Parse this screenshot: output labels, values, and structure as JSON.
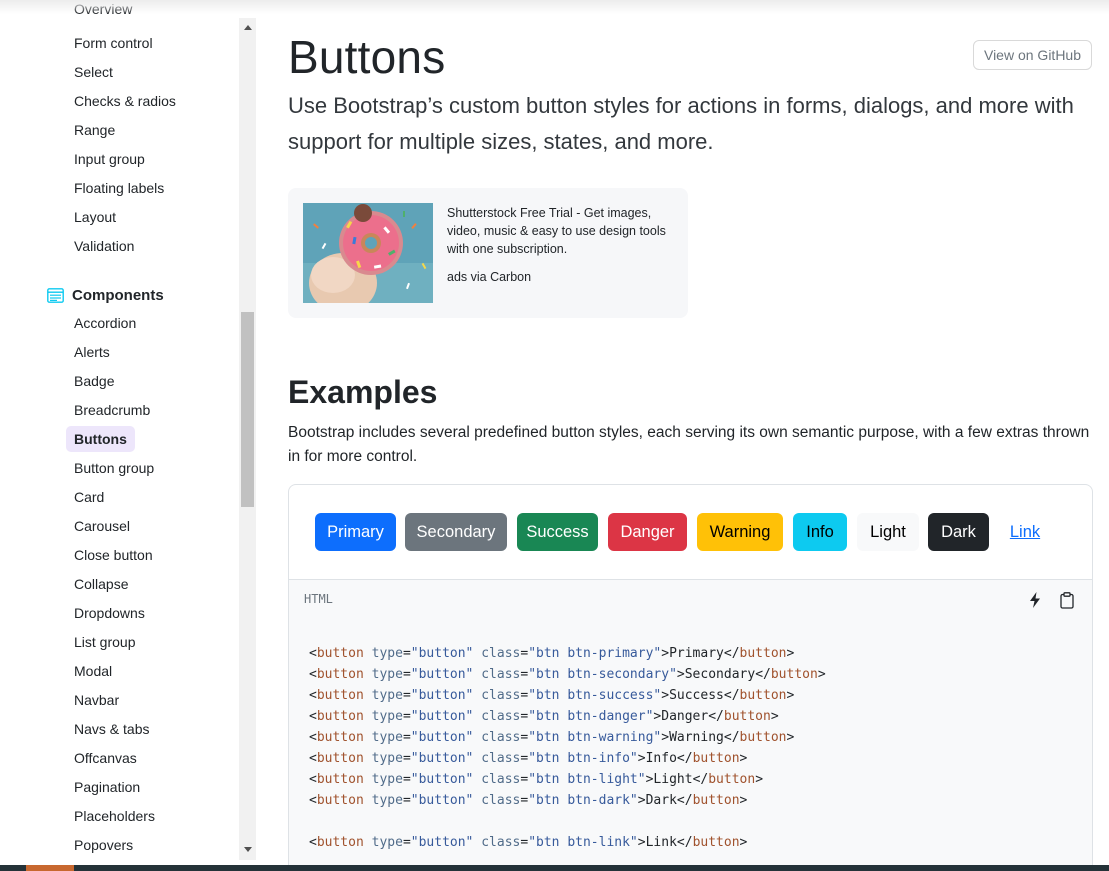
{
  "sidebar": {
    "cut_item": "Overview",
    "forms_items": [
      "Form control",
      "Select",
      "Checks & radios",
      "Range",
      "Input group",
      "Floating labels",
      "Layout",
      "Validation"
    ],
    "components_heading": "Components",
    "components_items": [
      "Accordion",
      "Alerts",
      "Badge",
      "Breadcrumb",
      "Buttons",
      "Button group",
      "Card",
      "Carousel",
      "Close button",
      "Collapse",
      "Dropdowns",
      "List group",
      "Modal",
      "Navbar",
      "Navs & tabs",
      "Offcanvas",
      "Pagination",
      "Placeholders",
      "Popovers"
    ],
    "active_item": "Buttons",
    "heading_icon": "components-icon",
    "heading_icon_color": "#0dcaf0",
    "active_bg": "#ede6fb"
  },
  "header": {
    "title": "Buttons",
    "github_button": "View on GitHub",
    "lead": "Use Bootstrap’s custom button styles for actions in forms, dialogs, and more with support for multiple sizes, states, and more."
  },
  "ad": {
    "text": "Shutterstock Free Trial - Get images, video, music & easy to use design tools with one subscription.",
    "via": "ads via Carbon",
    "image": "donut-photo"
  },
  "examples": {
    "heading": "Examples",
    "description": "Bootstrap includes several predefined button styles, each serving its own semantic purpose, with a few extras thrown in for more control.",
    "buttons": [
      {
        "label": "Primary",
        "bg": "#0d6efd",
        "color": "#ffffff"
      },
      {
        "label": "Secondary",
        "bg": "#6c757d",
        "color": "#ffffff"
      },
      {
        "label": "Success",
        "bg": "#198754",
        "color": "#ffffff"
      },
      {
        "label": "Danger",
        "bg": "#dc3545",
        "color": "#ffffff"
      },
      {
        "label": "Warning",
        "bg": "#ffc107",
        "color": "#000000"
      },
      {
        "label": "Info",
        "bg": "#0dcaf0",
        "color": "#000000"
      },
      {
        "label": "Light",
        "bg": "#f8f9fa",
        "color": "#000000"
      },
      {
        "label": "Dark",
        "bg": "#212529",
        "color": "#ffffff"
      },
      {
        "label": "Link",
        "bg": "transparent",
        "color": "#0d6efd"
      }
    ]
  },
  "code": {
    "language": "HTML",
    "icons": [
      "lightning-icon",
      "clipboard-icon"
    ],
    "lines": [
      {
        "cls": "btn btn-primary",
        "text": "Primary"
      },
      {
        "cls": "btn btn-secondary",
        "text": "Secondary"
      },
      {
        "cls": "btn btn-success",
        "text": "Success"
      },
      {
        "cls": "btn btn-danger",
        "text": "Danger"
      },
      {
        "cls": "btn btn-warning",
        "text": "Warning"
      },
      {
        "cls": "btn btn-info",
        "text": "Info"
      },
      {
        "cls": "btn btn-light",
        "text": "Light"
      },
      {
        "cls": "btn btn-dark",
        "text": "Dark"
      },
      {
        "cls": "btn btn-link",
        "text": "Link"
      }
    ],
    "tag": "button",
    "attr_type": "type",
    "type_value": "button",
    "attr_class": "class"
  }
}
